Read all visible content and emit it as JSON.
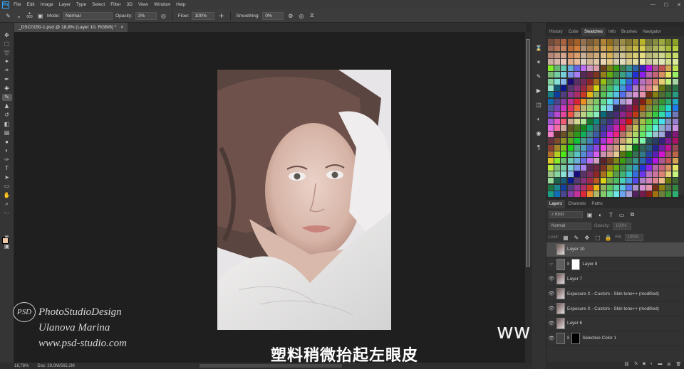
{
  "menu": {
    "logo": "Ps",
    "items": [
      "File",
      "Edit",
      "Image",
      "Layer",
      "Type",
      "Select",
      "Filter",
      "3D",
      "View",
      "Window",
      "Help"
    ],
    "window_controls": [
      "—",
      "☐",
      "✕"
    ]
  },
  "options": {
    "brush_size": "600",
    "mode_label": "Mode:",
    "mode_value": "Normal",
    "opacity_label": "Opacity:",
    "opacity_value": "3%",
    "flow_label": "Flow:",
    "flow_value": "100%",
    "smoothing_label": "Smoothing:",
    "smoothing_value": "0%"
  },
  "document": {
    "tab_title": "_DSC0150-1.psd @ 18,8% (Layer 10, RGB/8) *",
    "close_glyph": "×"
  },
  "status": {
    "zoom": "18,78%",
    "doc_size": "Doc: 29,0M/565,2M"
  },
  "overlays": {
    "logo_text": "PSD",
    "studio": "PhotoStudioDesign",
    "author": "Ulanova Marina",
    "url": "www.psd-studio.com",
    "subtitle": "塑料稍微抬起左眼皮",
    "site": "www.hunls.com"
  },
  "swatches_panel": {
    "tabs": [
      "History",
      "Color",
      "Swatches",
      "Info",
      "Brushes",
      "Navigator"
    ],
    "active_tab": "Swatches"
  },
  "layers_panel": {
    "tabs": [
      "Layers",
      "Channels",
      "Paths"
    ],
    "active_tab": "Layers",
    "filter_label": "Kind",
    "blend_mode": "Normal",
    "opacity_label": "Opacity:",
    "opacity_value": "100%",
    "lock_label": "Lock:",
    "fill_label": "Fill:",
    "fill_value": "100%",
    "layers": [
      {
        "name": "Layer 10",
        "selected": true,
        "visible": false,
        "thumb": "photo"
      },
      {
        "name": "Layer 8",
        "selected": false,
        "visible": false,
        "thumb": "white",
        "masked": true
      },
      {
        "name": "Layer 7",
        "selected": false,
        "visible": true,
        "thumb": "photo"
      },
      {
        "name": "Exposure X - Custom - Skin tone++ (modified)",
        "selected": false,
        "visible": true,
        "thumb": "photo"
      },
      {
        "name": "Exposure X - Custom - Skin tone++ (modified)",
        "selected": false,
        "visible": true,
        "thumb": "photo"
      },
      {
        "name": "Layer 6",
        "selected": false,
        "visible": true,
        "thumb": "photo"
      },
      {
        "name": "Selective Color 1",
        "selected": false,
        "visible": true,
        "thumb": "black",
        "masked": true
      }
    ],
    "footer_icons": [
      "link-icon",
      "fx-icon",
      "mask-icon",
      "adjustment-icon",
      "folder-icon",
      "new-layer-icon",
      "trash-icon"
    ]
  },
  "colors": {
    "accent": "#31a8ff",
    "foreground": "#f0c9a5",
    "background": "#d82a66"
  }
}
